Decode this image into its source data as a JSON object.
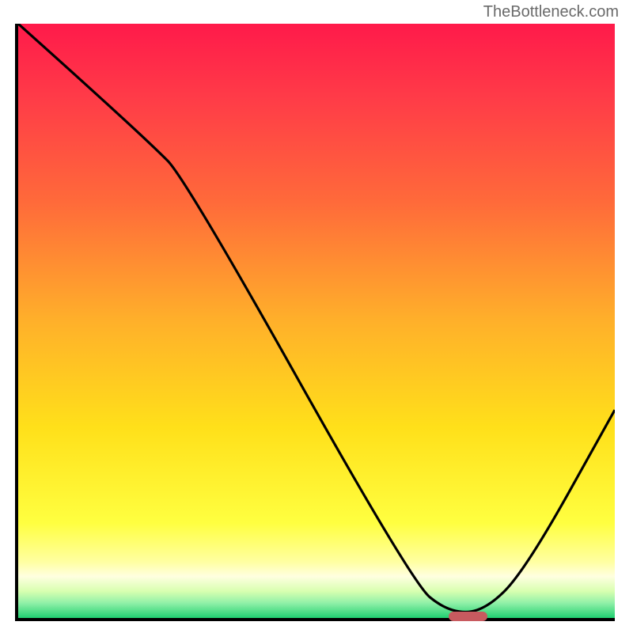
{
  "watermark": "TheBottleneck.com",
  "chart_data": {
    "type": "line",
    "title": "",
    "xlabel": "",
    "ylabel": "",
    "xlim": [
      0,
      100
    ],
    "ylim": [
      0,
      100
    ],
    "grid": false,
    "legend": false,
    "background_gradient": {
      "stops": [
        {
          "pos": 0.0,
          "color": "#ff1a4a"
        },
        {
          "pos": 0.12,
          "color": "#ff3a48"
        },
        {
          "pos": 0.3,
          "color": "#ff6a3a"
        },
        {
          "pos": 0.5,
          "color": "#ffb02a"
        },
        {
          "pos": 0.68,
          "color": "#ffe01a"
        },
        {
          "pos": 0.84,
          "color": "#ffff40"
        },
        {
          "pos": 0.905,
          "color": "#ffffa0"
        },
        {
          "pos": 0.93,
          "color": "#ffffe0"
        },
        {
          "pos": 0.955,
          "color": "#d8ffb0"
        },
        {
          "pos": 0.975,
          "color": "#90f0a8"
        },
        {
          "pos": 1.0,
          "color": "#20d070"
        }
      ]
    },
    "series": [
      {
        "name": "bottleneck-curve",
        "color": "#000000",
        "x": [
          0,
          10,
          22,
          28,
          66,
          72,
          78,
          85,
          100
        ],
        "y": [
          100,
          91,
          80,
          74,
          6,
          1,
          1,
          8,
          35
        ]
      }
    ],
    "marker": {
      "name": "optimal-point",
      "x": 75,
      "y": 0.8,
      "width_pct": 6.5,
      "height_pct": 1.6,
      "color": "#c85a5f"
    }
  }
}
